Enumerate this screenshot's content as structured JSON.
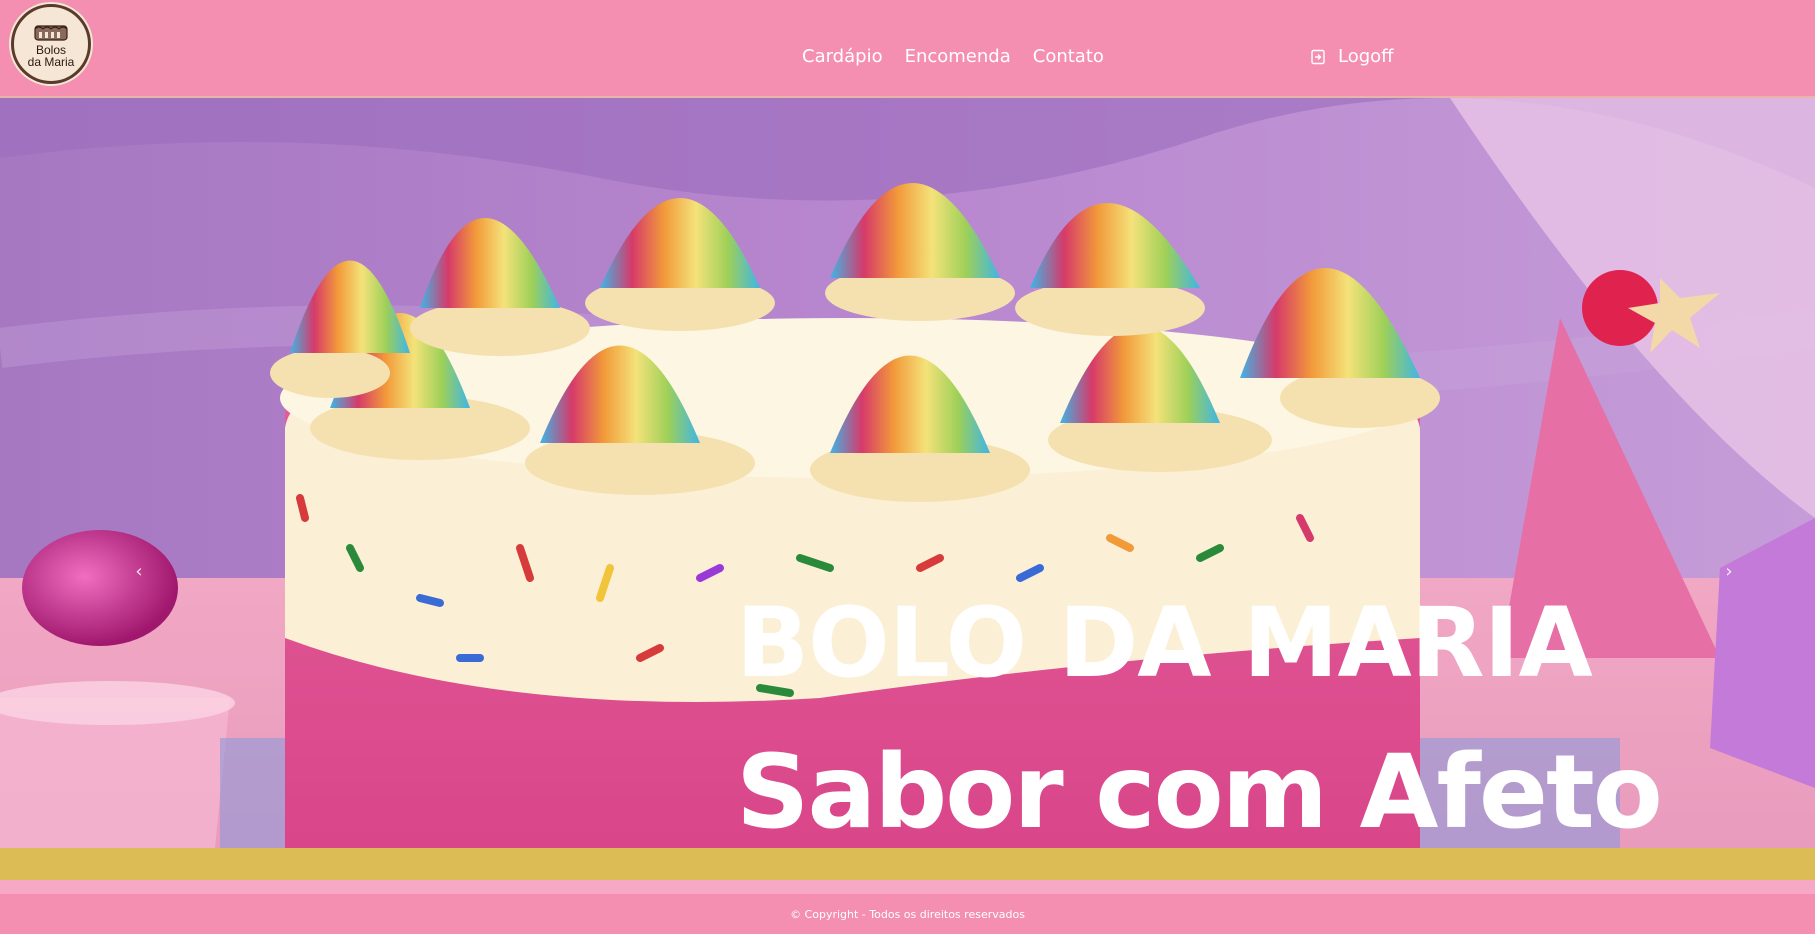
{
  "brand": {
    "logo_line1": "Bolos",
    "logo_line2": "da Maria"
  },
  "nav": {
    "items": [
      {
        "label": "Cardápio"
      },
      {
        "label": "Encomenda"
      },
      {
        "label": "Contato"
      }
    ],
    "logoff_label": "Logoff",
    "logoff_icon": "sign-in-icon"
  },
  "hero": {
    "title": "BOLO DA MARIA",
    "subtitle": "Sabor com Afeto",
    "prev_icon": "‹",
    "next_icon": "›"
  },
  "footer": {
    "copyright": "© Copyright - Todos os direitos reservados"
  },
  "colors": {
    "nav_bg": "#f48fb1",
    "gold_bar": "#dcbc55",
    "text": "#ffffff"
  }
}
